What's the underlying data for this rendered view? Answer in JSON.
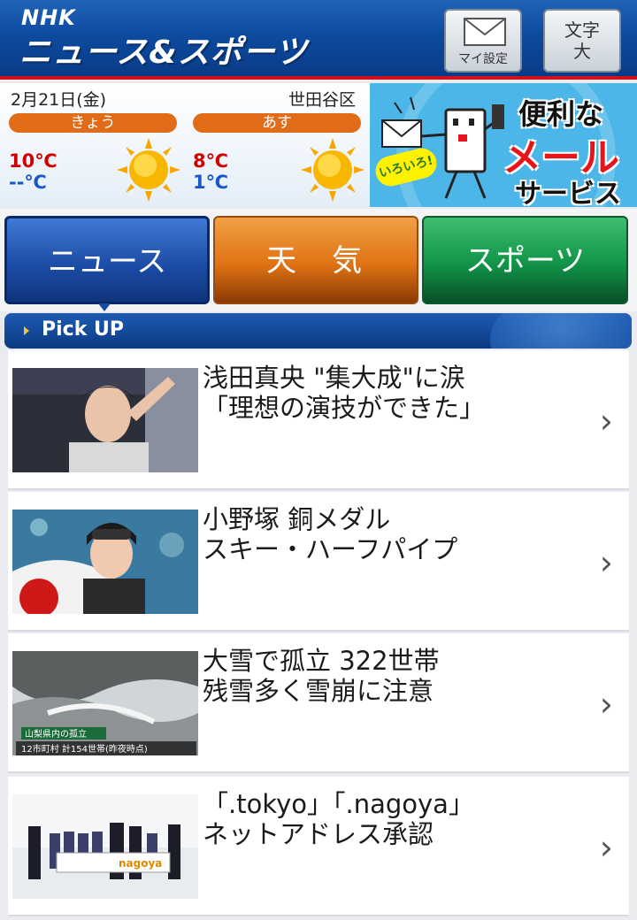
{
  "header": {
    "logo_nhk": "NHK",
    "logo_title": "ニュース&スポーツ",
    "my_settings_label": "マイ設定",
    "font_size_label_1": "文字",
    "font_size_label_2": "大"
  },
  "weather": {
    "date": "2月21日(金)",
    "location": "世田谷区",
    "today": {
      "label": "きょう",
      "high": "10℃",
      "low": "--℃",
      "icon": "sun-icon"
    },
    "tomorrow": {
      "label": "あす",
      "high": "8℃",
      "low": "1℃",
      "icon": "sun-icon"
    }
  },
  "banner": {
    "line1": "便利な",
    "line2": "メール",
    "line3": "サービス",
    "tag": "いろいろ!"
  },
  "tabs": [
    {
      "label": "ニュース"
    },
    {
      "label": "天気"
    },
    {
      "label": "スポーツ"
    }
  ],
  "pickup": {
    "label": "Pick UP"
  },
  "news": [
    {
      "headline": "浅田真央 \"集大成\"に涙\n「理想の演技ができた」"
    },
    {
      "headline": "小野塚 銅メダル\nスキー・ハーフパイプ"
    },
    {
      "headline": "大雪で孤立 322世帯\n残雪多く雪崩に注意",
      "thumb_caption1": "山梨県内の孤立",
      "thumb_caption2": "12市町村 計154世帯(昨夜時点)"
    },
    {
      "headline": "「.tokyo」「.nagoya」\nネットアドレス承認",
      "thumb_caption1": "nagoya"
    }
  ],
  "colors": {
    "header_blue": "#0d4a9e",
    "accent_red": "#d0101a",
    "pill_orange": "#e06c17",
    "tab_news": "#1b4aa3",
    "tab_weather": "#e07314",
    "tab_sports": "#119448"
  }
}
